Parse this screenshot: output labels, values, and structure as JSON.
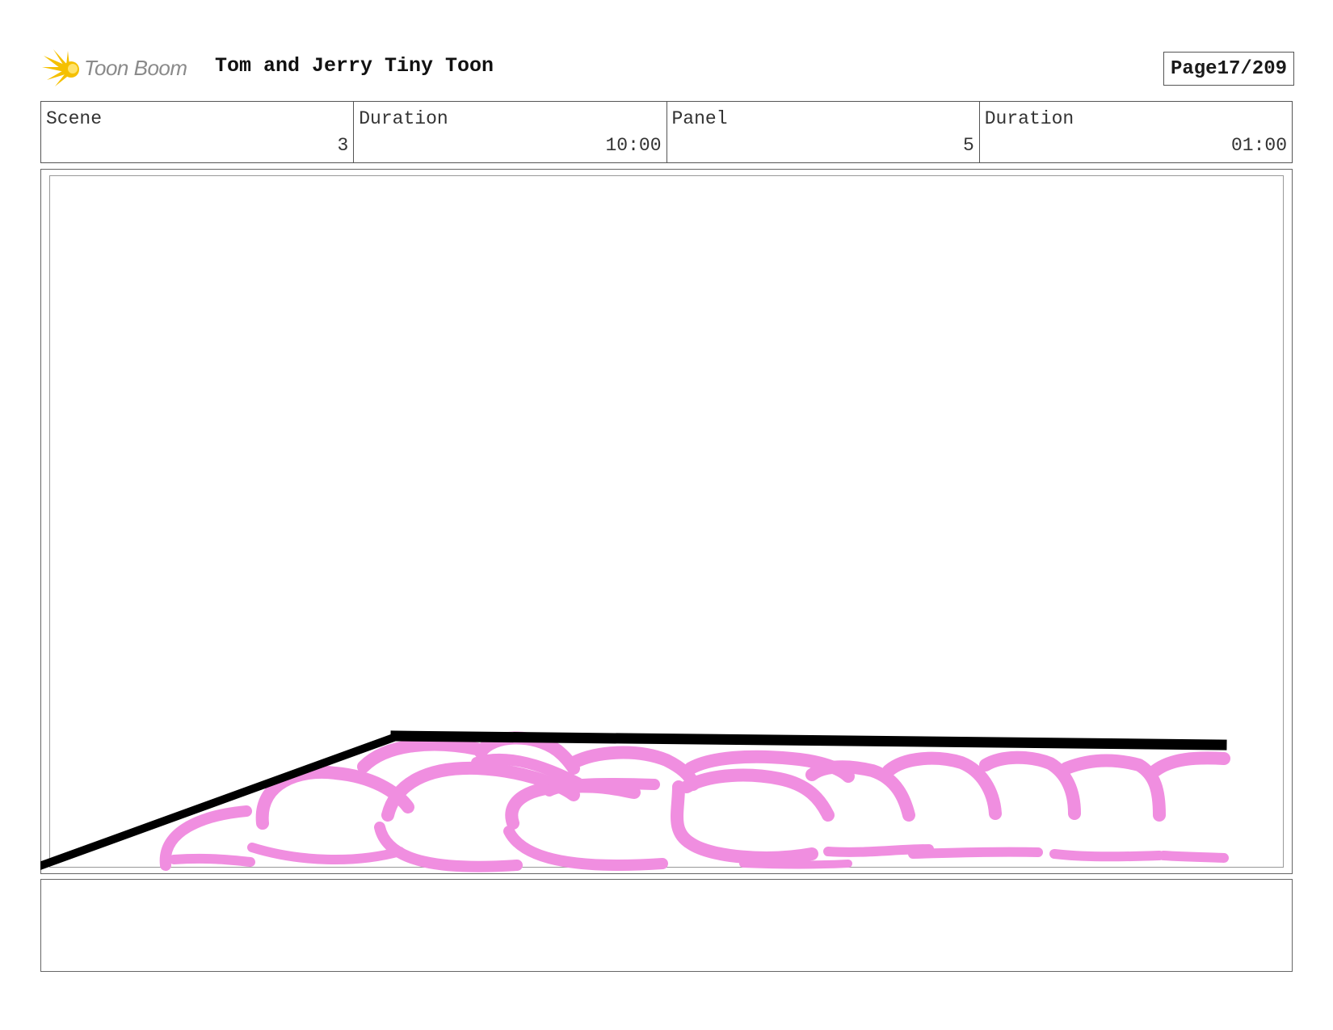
{
  "header": {
    "logo_text": "Toon Boom",
    "logo_icon": "starburst-logo-icon",
    "project_title": "Tom and Jerry Tiny Toon",
    "page_label": "Page",
    "page_number": "17/209"
  },
  "info": {
    "scene_label": "Scene",
    "scene_value": "3",
    "scene_duration_label": "Duration",
    "scene_duration_value": "10:00",
    "panel_label": "Panel",
    "panel_value": "5",
    "panel_duration_label": "Duration",
    "panel_duration_value": "01:00"
  },
  "colors": {
    "sketch_pink": "#f08ee0",
    "ground_line": "#000000",
    "logo_yellow": "#f5c000"
  },
  "notes": {
    "text": ""
  }
}
